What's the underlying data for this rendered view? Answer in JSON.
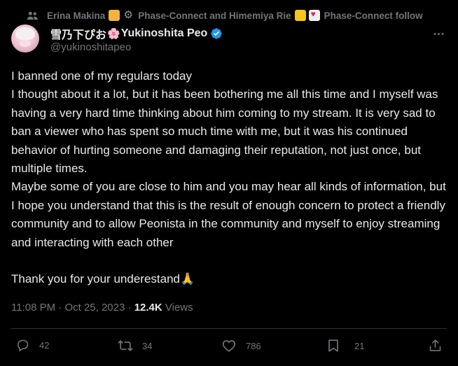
{
  "social_context": {
    "prefix": "Erina Makina",
    "middle": "Phase-Connect and Himemiya Rie",
    "suffix": "Phase-Connect follow",
    "emoji_1": "tiger-emoji",
    "emoji_2": "gear-emoji",
    "emoji_3": "crown-emoji",
    "emoji_4": "love-letter-emoji"
  },
  "author": {
    "display_name_jp": "雪乃下ぴお",
    "flower": "🌸",
    "display_name_en": "Yukinoshita Peo",
    "handle": "@yukinoshitapeo",
    "verified_color": "#1d9bf0"
  },
  "tweet": {
    "text": "I banned one of my regulars today\nI thought about it a lot, but it has been bothering me all this time and I myself was having a very hard time thinking about him coming to my stream. It is very sad to ban a viewer who has spent so much time with me, but it was his continued behavior of hurting someone and damaging their reputation, not just once, but multiple times.\nMaybe some of you are close to him and you may hear all kinds of information, but I hope you understand that this is the result of enough concern to protect a friendly community and to allow Peonista in the community and myself to enjoy streaming and interacting with each other\n\nThank you for your underestand",
    "emoji_end": "🙏"
  },
  "meta": {
    "time": "11:08 PM",
    "separator": " · ",
    "date": "Oct 25, 2023",
    "views_count": "12.4K",
    "views_label": "Views"
  },
  "actions": {
    "replies": "42",
    "reposts": "34",
    "likes": "786",
    "bookmarks": "21"
  },
  "colors": {
    "background": "#000000",
    "text": "#e7e9ea",
    "secondary": "#71767b",
    "divider": "#2f3336"
  }
}
